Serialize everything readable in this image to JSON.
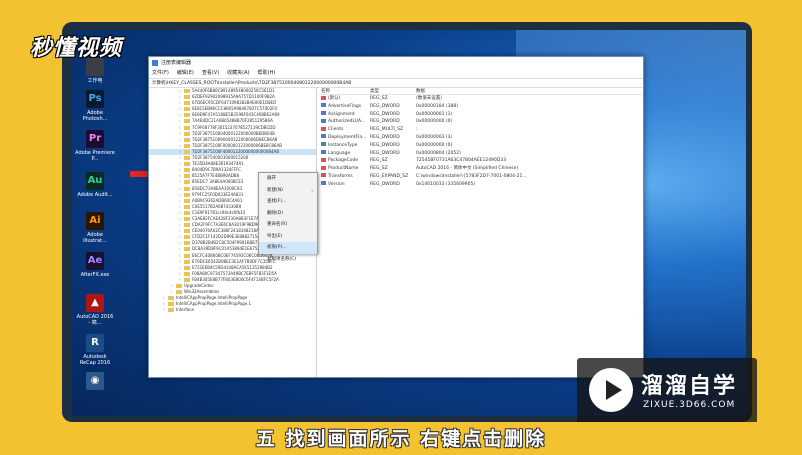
{
  "brand": "秒懂视频",
  "caption": "五 找到画面所示 右键点击删除",
  "watermark": {
    "name": "溜溜自学",
    "url": "ZIXUE.3D66.COM"
  },
  "desktop_icons": [
    {
      "label": "工作电",
      "glyph": "",
      "bg": "#3a3f46",
      "fg": "#fff"
    },
    {
      "label": "Adobe Photosh...",
      "glyph": "Ps",
      "bg": "#0a1a2e",
      "fg": "#3fa9f5"
    },
    {
      "label": "Adobe Premiere P...",
      "glyph": "Pr",
      "bg": "#1f0b2d",
      "fg": "#e18bff"
    },
    {
      "label": "Adobe Audit...",
      "glyph": "Au",
      "bg": "#0b2a22",
      "fg": "#2bd0a0"
    },
    {
      "label": "Adobe Illustrat...",
      "glyph": "Ai",
      "bg": "#2b1400",
      "fg": "#ff9a00"
    },
    {
      "label": "AfterFX.exe",
      "glyph": "Ae",
      "bg": "#1a0f2e",
      "fg": "#9b8bff"
    },
    {
      "label": "AutoCAD 2016 - 简...",
      "glyph": "▲",
      "bg": "#b01414",
      "fg": "#fff"
    },
    {
      "label": "Autodesk ReCap 2016",
      "glyph": "R",
      "bg": "#1a4c8a",
      "fg": "#fff"
    },
    {
      "label": "",
      "glyph": "◉",
      "bg": "#2b5a8a",
      "fg": "#fff"
    }
  ],
  "regedit": {
    "title": "注册表编辑器",
    "menu": [
      "文件(F)",
      "编辑(E)",
      "查看(V)",
      "收藏夹(A)",
      "帮助(H)"
    ],
    "address": "计算机\\HKEY_CLASSES_ROOT\\Installer\\Products\\7D2F387510004080122000000000B4AB",
    "tree": [
      "5A440F6B80C891489548060256C561D1",
      "62DEF92902098935A9A757D1100F9B2A",
      "67D6EC95CDF6471098382BAE00E1D8ED",
      "6E815EB96CCC8665A98467837C57002F0",
      "6E8D9F47A5168E5B3598F643C468BE2A69",
      "7A4B4DC21A0B65488B70F2851295B6A",
      "7C9F68778F3015237078527119CDBCDD",
      "7D2F387510004000122000000B6DB04B",
      "7D2F387510090000122000006D8EC86AB",
      "7D2F3875100F000000122000006BE8C86AB",
      "7D2F3875100F400012200000000000B4AB",
      "7D2F387540003000015200",
      "7E35D4A88E36193474A1",
      "8404D9C7B9A1324FFFC",
      "8525A7F7E4BB90ADB8",
      "85EDC7 3A8EAA000BCE3",
      "858DC73A8EAA1000C83",
      "979FC25F0D033E24A831",
      "A0B9C9362ADB60C4A61",
      "C0E5517B2A6874330B9",
      "C1E9F91781cc94c4c6fb15",
      "C3AE82FCAE428F230A8B3F1E7A5AB7F",
      "CDA2F9FC7A3E6C6A3019F9BD90D5C26",
      "CE04070A02C380F2418348218A2D28F3",
      "CFD2C1F142D2D99E3E88827154304A9F98",
      "D378B2B4B2C8C504F9901B8B77789F88",
      "DC8A39D8F9C01A53894E1E67520E18B",
      "E6CFC40B60BC0EF74593C06C08D6078",
      "E70DCE6542B0BEC3E1AF7B0DF7C358FC",
      "E721EEB4C59D4348ACA5E51352984B2",
      "F08A80C97347573A49BC7EBF5F83F1D5A",
      "FB4B305E8B77FB03EB00C6F4F14BFC5F2A",
      "UpgradeCodes",
      "Win32Assemblies",
      "IntelliCAppPropPage.IntelliPropPage",
      "IntelliCAppPropPage.IntelliPropPage.1",
      "Interface"
    ],
    "value_headers": [
      "名称",
      "类型",
      "数据"
    ],
    "values": [
      {
        "name": "(默认)",
        "type": "REG_SZ",
        "data": "(数值未设置)",
        "kind": "ab"
      },
      {
        "name": "AdvertiseFlags",
        "type": "REG_DWORD",
        "data": "0x00000184 (388)",
        "kind": "dw"
      },
      {
        "name": "Assignment",
        "type": "REG_DWORD",
        "data": "0x00000001 (1)",
        "kind": "dw"
      },
      {
        "name": "AuthorizedLUA...",
        "type": "REG_DWORD",
        "data": "0x00000000 (0)",
        "kind": "dw"
      },
      {
        "name": "Clients",
        "type": "REG_MULTI_SZ",
        "data": ":",
        "kind": "ab"
      },
      {
        "name": "DeploymentFla...",
        "type": "REG_DWORD",
        "data": "0x00000003 (3)",
        "kind": "dw"
      },
      {
        "name": "InstanceType",
        "type": "REG_DWORD",
        "data": "0x00000000 (0)",
        "kind": "dw"
      },
      {
        "name": "Language",
        "type": "REG_DWORD",
        "data": "0x00000804 (2052)",
        "kind": "dw"
      },
      {
        "name": "PackageCode",
        "type": "REG_SZ",
        "data": "72545BF0731A63C47804AEE12490D33",
        "kind": "ab"
      },
      {
        "name": "ProductName",
        "type": "REG_SZ",
        "data": "AutoCAD 2016 - 简体中文 (Simplified Chinese)",
        "kind": "ab"
      },
      {
        "name": "Transforms",
        "type": "REG_EXPAND_SZ",
        "data": "C:\\windows\\Installer\\{5783F2D7-7001-0804-21...",
        "kind": "ab"
      },
      {
        "name": "Version",
        "type": "REG_DWORD",
        "data": "0x14010033 (335609905)",
        "kind": "dw"
      }
    ],
    "context_menu": [
      {
        "label": "展开",
        "sub": false,
        "hl": false
      },
      {
        "label": "新建(N)",
        "sub": true,
        "hl": false
      },
      {
        "label": "查找(F)...",
        "sub": false,
        "hl": false
      },
      {
        "label": "删除(D)",
        "sub": false,
        "hl": false
      },
      {
        "label": "重命名(R)",
        "sub": false,
        "hl": false
      },
      {
        "label": "导出(E)",
        "sub": false,
        "hl": false
      },
      {
        "label": "权限(P)...",
        "sub": false,
        "hl": true
      },
      {
        "label": "复制项名称(C)",
        "sub": false,
        "hl": false
      }
    ]
  }
}
